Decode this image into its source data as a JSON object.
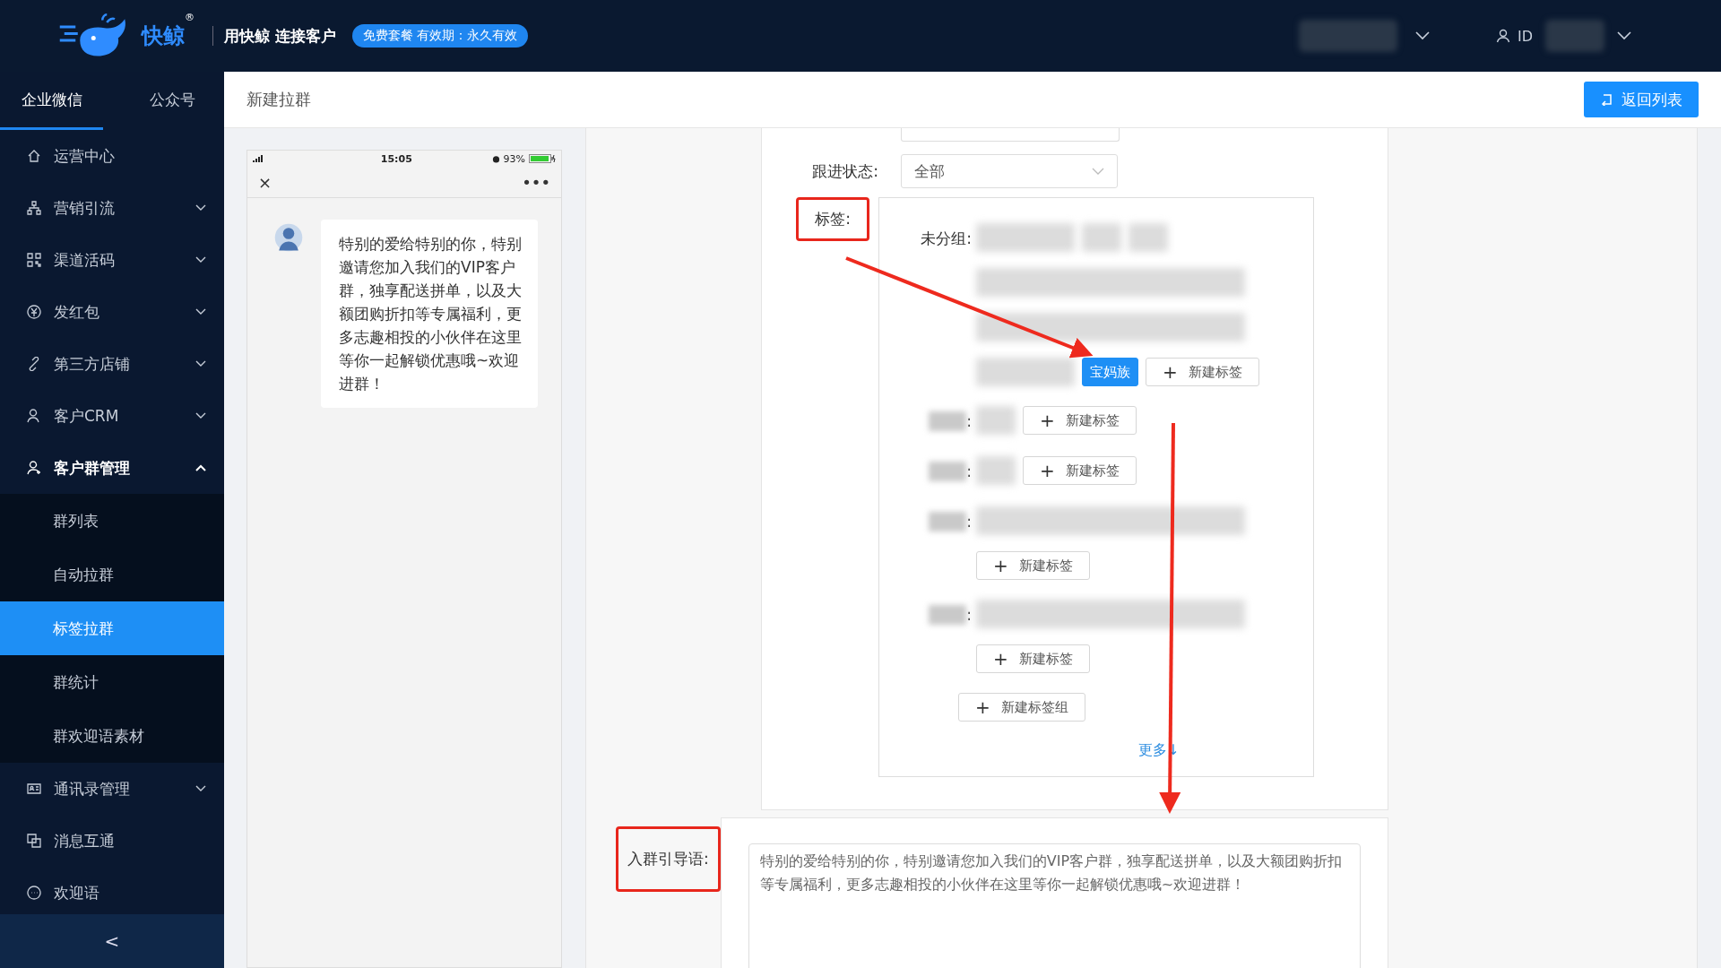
{
  "header": {
    "brand": "快鲸",
    "brand_mark": "®",
    "slogan": "用快鲸 连接客户",
    "plan_badge": "免费套餐 有效期：永久有效",
    "user_label": "ID"
  },
  "sidebar": {
    "tabs": [
      {
        "label": "企业微信",
        "selected": true
      },
      {
        "label": "公众号",
        "selected": false
      }
    ],
    "items": [
      {
        "label": "运营中心",
        "selected": false
      },
      {
        "label": "营销引流",
        "selected": false,
        "expanded": false
      },
      {
        "label": "渠道活码",
        "selected": false,
        "expanded": false
      },
      {
        "label": "发红包",
        "selected": false,
        "expanded": false
      },
      {
        "label": "第三方店铺",
        "selected": false,
        "expanded": false
      },
      {
        "label": "客户CRM",
        "selected": false,
        "expanded": false
      },
      {
        "label": "客户群管理",
        "selected": false,
        "expanded": true,
        "children": [
          {
            "label": "群列表",
            "selected": false
          },
          {
            "label": "自动拉群",
            "selected": false
          },
          {
            "label": "标签拉群",
            "selected": true
          },
          {
            "label": "群统计",
            "selected": false
          },
          {
            "label": "群欢迎语素材",
            "selected": false
          }
        ]
      },
      {
        "label": "通讯录管理",
        "selected": false,
        "expanded": false
      },
      {
        "label": "消息互通",
        "selected": false
      },
      {
        "label": "欢迎语",
        "selected": false
      }
    ],
    "collapse": "<"
  },
  "page": {
    "title": "新建拉群",
    "back_button": "返回列表"
  },
  "preview": {
    "time": "15:05",
    "battery": "93%",
    "close": "×",
    "more": "•••",
    "message": "特别的爱给特别的你，特别邀请您加入我们的VIP客户群，独享配送拼单，以及大额团购折扣等专属福利，更多志趣相投的小伙伴在这里等你一起解锁优惠哦~欢迎进群！"
  },
  "form": {
    "follow_label": "跟进状态:",
    "follow_value": "全部",
    "tags_label": "标签:",
    "tag_groups": [
      {
        "kind": "named",
        "label": "未分组:",
        "rows": [
          [
            {
              "kind": "medium"
            },
            {
              "kind": "short"
            },
            {
              "kind": "short"
            }
          ],
          [
            {
              "kind": "long"
            }
          ],
          [
            {
              "kind": "long"
            }
          ],
          [
            {
              "kind": "medium"
            },
            {
              "kind": "tag",
              "text": "宝妈族",
              "selected": true
            },
            {
              "kind": "new_tag",
              "plus": "+",
              "text": "新建标签"
            }
          ]
        ]
      },
      {
        "kind": "redacted",
        "label": ":",
        "rows": [
          [
            {
              "kind": "short"
            },
            {
              "kind": "new_tag",
              "plus": "+",
              "text": "新建标签"
            }
          ]
        ]
      },
      {
        "kind": "redacted",
        "label": ":",
        "rows": [
          [
            {
              "kind": "short"
            },
            {
              "kind": "new_tag",
              "plus": "+",
              "text": "新建标签"
            }
          ]
        ]
      },
      {
        "kind": "redacted",
        "label": ":",
        "rows": [
          [
            {
              "kind": "long"
            }
          ],
          [
            {
              "kind": "new_tag",
              "plus": "+",
              "text": "新建标签"
            }
          ]
        ]
      },
      {
        "kind": "redacted",
        "label": ":",
        "rows": [
          [
            {
              "kind": "long"
            }
          ],
          [
            {
              "kind": "new_tag",
              "plus": "+",
              "text": "新建标签"
            }
          ]
        ]
      }
    ],
    "new_group_plus": "+",
    "new_group": "新建标签组",
    "more": "更多↓",
    "intro_label": "入群引导语:",
    "intro_value": "特别的爱给特别的你，特别邀请您加入我们的VIP客户群，独享配送拼单，以及大额团购折扣等专属福利，更多志趣相投的小伙伴在这里等你一起解锁优惠哦~欢迎进群！"
  }
}
